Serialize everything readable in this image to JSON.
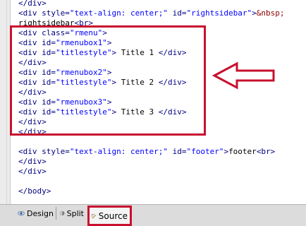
{
  "editor": {
    "lines": [
      [
        {
          "t": "tag",
          "v": "</div>"
        }
      ],
      [
        {
          "t": "tag",
          "v": "<div "
        },
        {
          "t": "attr",
          "v": "style="
        },
        {
          "t": "val",
          "v": "\"text-align: center;\""
        },
        {
          "t": "attr",
          "v": " id="
        },
        {
          "t": "val",
          "v": "\"rightsidebar\""
        },
        {
          "t": "tag",
          "v": ">"
        },
        {
          "t": "ent",
          "v": "&nbsp;"
        }
      ],
      [
        {
          "t": "text",
          "v": "rightsidebar"
        },
        {
          "t": "tag",
          "v": "<br>"
        }
      ],
      [
        {
          "t": "tag",
          "v": "<div "
        },
        {
          "t": "attr",
          "v": "class="
        },
        {
          "t": "val",
          "v": "\"rmenu\""
        },
        {
          "t": "tag",
          "v": ">"
        }
      ],
      [
        {
          "t": "tag",
          "v": "<div "
        },
        {
          "t": "attr",
          "v": "id="
        },
        {
          "t": "val",
          "v": "\"rmenubox1\""
        },
        {
          "t": "tag",
          "v": ">"
        }
      ],
      [
        {
          "t": "tag",
          "v": "<div "
        },
        {
          "t": "attr",
          "v": "id="
        },
        {
          "t": "val",
          "v": "\"titlestyle\""
        },
        {
          "t": "tag",
          "v": ">"
        },
        {
          "t": "text",
          "v": " Title 1 "
        },
        {
          "t": "tag",
          "v": "</div>"
        }
      ],
      [
        {
          "t": "tag",
          "v": "</div>"
        }
      ],
      [
        {
          "t": "tag",
          "v": "<div "
        },
        {
          "t": "attr",
          "v": "id="
        },
        {
          "t": "val",
          "v": "\"rmenubox2\""
        },
        {
          "t": "tag",
          "v": ">"
        }
      ],
      [
        {
          "t": "tag",
          "v": "<div "
        },
        {
          "t": "attr",
          "v": "id="
        },
        {
          "t": "val",
          "v": "\"titlestyle\""
        },
        {
          "t": "tag",
          "v": ">"
        },
        {
          "t": "text",
          "v": " Title 2 "
        },
        {
          "t": "tag",
          "v": "</div>"
        }
      ],
      [
        {
          "t": "tag",
          "v": "</div>"
        }
      ],
      [
        {
          "t": "tag",
          "v": "<div "
        },
        {
          "t": "attr",
          "v": "id="
        },
        {
          "t": "val",
          "v": "\"rmenubox3\""
        },
        {
          "t": "tag",
          "v": ">"
        }
      ],
      [
        {
          "t": "tag",
          "v": "<div "
        },
        {
          "t": "attr",
          "v": "id="
        },
        {
          "t": "val",
          "v": "\"titlestyle\""
        },
        {
          "t": "tag",
          "v": ">"
        },
        {
          "t": "text",
          "v": " Title 3 "
        },
        {
          "t": "tag",
          "v": "</div>"
        }
      ],
      [
        {
          "t": "tag",
          "v": "</div>"
        }
      ],
      [
        {
          "t": "tag",
          "v": "</div>"
        }
      ],
      [],
      [
        {
          "t": "tag",
          "v": "<div "
        },
        {
          "t": "attr",
          "v": "style="
        },
        {
          "t": "val",
          "v": "\"text-align: center;\""
        },
        {
          "t": "attr",
          "v": " id="
        },
        {
          "t": "val",
          "v": "\"footer\""
        },
        {
          "t": "tag",
          "v": ">"
        },
        {
          "t": "text",
          "v": "footer"
        },
        {
          "t": "tag",
          "v": "<br>"
        }
      ],
      [
        {
          "t": "tag",
          "v": "</div>"
        }
      ],
      [
        {
          "t": "tag",
          "v": "</div>"
        }
      ],
      [],
      [
        {
          "t": "tag",
          "v": "</body>"
        }
      ]
    ]
  },
  "viewbar": {
    "design_label": "Design",
    "split_label": "Split",
    "source_label": "Source"
  },
  "icons": {
    "design": "eye-icon",
    "split": "split-view-icon",
    "source": "source-code-icon"
  },
  "colors": {
    "highlight": "#c8102e",
    "tag": "#000080",
    "value": "#0000ff"
  }
}
